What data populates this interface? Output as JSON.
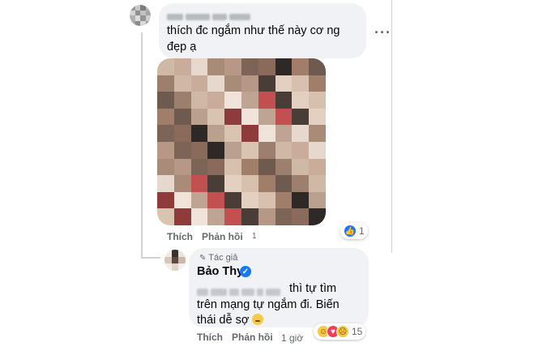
{
  "comment1": {
    "text_line1": "thích đc ngắm như thế này cơ ng",
    "text_line2": "đẹp ạ",
    "more_icon": "more-horizontal-icon",
    "reaction": {
      "icon": "like-icon",
      "count": "1"
    },
    "actions": {
      "like": "Thích",
      "reply": "Phản hồi",
      "time": "1"
    }
  },
  "reply": {
    "author_tag": "Tác giả",
    "author_name": "Bảo Thy",
    "text_line1_visible": "thì tự tìm",
    "text_line2": "trên mạng tự ngắm đi. Biến",
    "text_line3": "thái dễ sợ",
    "reactions": {
      "icons": [
        "haha-icon",
        "love-icon",
        "sad-icon"
      ],
      "count": "15"
    },
    "actions": {
      "like": "Thích",
      "reply": "Phản hồi",
      "time": "1 giờ"
    }
  },
  "colors": {
    "like_blue": "#1877f2",
    "love_red": "#f33e58",
    "haha_yellow": "#f7c948",
    "bubble": "#f0f2f5",
    "meta_grey": "#65676b"
  }
}
